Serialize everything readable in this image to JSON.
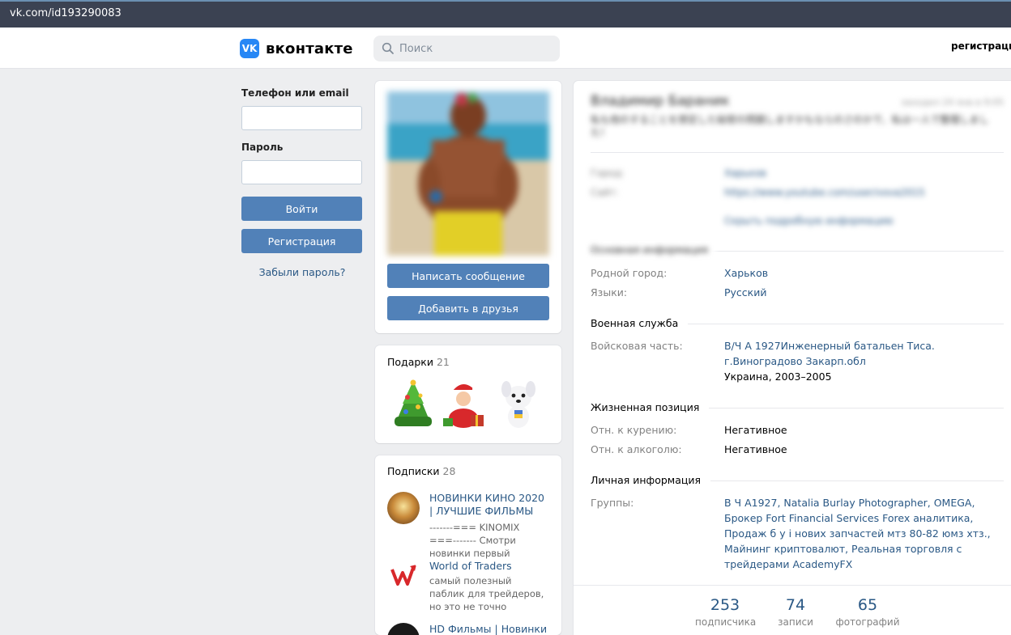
{
  "browser": {
    "url": "vk.com/id193290083"
  },
  "header": {
    "logo_text": "вконтакте",
    "logo_mark": "VK",
    "search_placeholder": "Поиск",
    "register_link": "регистрация"
  },
  "login": {
    "phone_label": "Телефон или email",
    "password_label": "Пароль",
    "login_button": "Войти",
    "register_button": "Регистрация",
    "forgot_link": "Забыли пароль?"
  },
  "profile_actions": {
    "message_button": "Написать сообщение",
    "add_friend_button": "Добавить в друзья"
  },
  "gifts": {
    "title": "Подарки",
    "count": "21"
  },
  "subscriptions": {
    "title": "Подписки",
    "count": "28",
    "items": [
      {
        "name": "НОВИНКИ КИНО 2020 | ЛУЧШИЕ ФИЛЬМЫ",
        "desc": "-------=== KINOMIX ===------- Смотри новинки первый"
      },
      {
        "name": "World of Traders",
        "desc": "самый полезный паблик для трейдеров, но это не точно"
      },
      {
        "name": "HD Фильмы | Новинки",
        "desc": ""
      }
    ]
  },
  "profile": {
    "name_blurred": "Владимир Бараник",
    "online_blurred": "заходил 24 янв в 9:05",
    "status_blurred": "私も他のすることを想定した秘密の問題しますかもならのさのかで、私は一人で整理しました！",
    "city_label_blurred": "Город:",
    "city_value_blurred": "Харьков",
    "site_label_blurred": "Сайт:",
    "site_value_blurred": "https://www.youtube.com/user/vova2015",
    "hide_details_blurred": "Скрыть подробную информацию",
    "main_info_blurred": "Основная информация",
    "hometown_label": "Родной город:",
    "hometown_value": "Харьков",
    "languages_label": "Языки:",
    "languages_value": "Русский",
    "military_title": "Военная служба",
    "unit_label": "Войсковая часть:",
    "unit_value": "В/Ч А 1927Инженерный батальен Тиса. г.Виноградово Закарп.обл",
    "unit_place": "Украина, 2003–2005",
    "life_title": "Жизненная позиция",
    "smoking_label": "Отн. к курению:",
    "smoking_value": "Негативное",
    "alcohol_label": "Отн. к алкоголю:",
    "alcohol_value": "Негативное",
    "personal_title": "Личная информация",
    "groups_label": "Группы:",
    "groups_value": "В Ч А1927, Natalia Burlay Photographer, OMEGA, Брокер Fort Financial Services Forex аналитика, Продаж б у і нових запчастей мтз 80-82 юмз хтз., Майнинг криптовалют, Реальная торговля с трейдерами AcademyFX"
  },
  "counters": [
    {
      "num": "253",
      "label": "подписчика"
    },
    {
      "num": "74",
      "label": "записи"
    },
    {
      "num": "65",
      "label": "фотографий"
    }
  ],
  "colors": {
    "accent": "#5181b8",
    "link": "#2a5885",
    "bg": "#edeef0"
  }
}
